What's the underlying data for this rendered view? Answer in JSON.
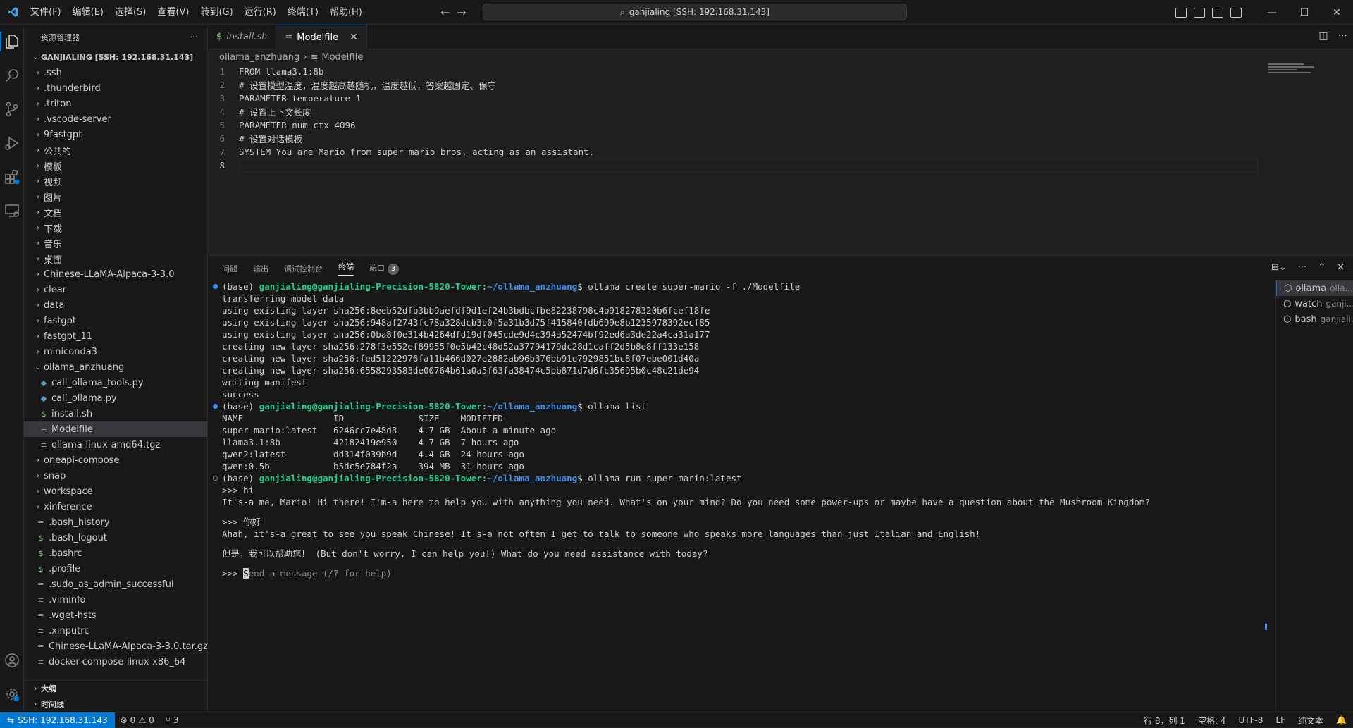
{
  "menu": [
    "文件(F)",
    "编辑(E)",
    "选择(S)",
    "查看(V)",
    "转到(G)",
    "运行(R)",
    "终端(T)",
    "帮助(H)"
  ],
  "command_center": "ganjialing [SSH: 192.168.31.143]",
  "sidebar": {
    "title": "资源管理器",
    "root": "GANJIALING [SSH: 192.168.31.143]",
    "items": [
      {
        "label": ".ssh",
        "type": "folder",
        "depth": 0
      },
      {
        "label": ".thunderbird",
        "type": "folder",
        "depth": 0
      },
      {
        "label": ".triton",
        "type": "folder",
        "depth": 0
      },
      {
        "label": ".vscode-server",
        "type": "folder",
        "depth": 0
      },
      {
        "label": "9fastgpt",
        "type": "folder",
        "depth": 0
      },
      {
        "label": "公共的",
        "type": "folder",
        "depth": 0
      },
      {
        "label": "模板",
        "type": "folder",
        "depth": 0
      },
      {
        "label": "视频",
        "type": "folder",
        "depth": 0
      },
      {
        "label": "图片",
        "type": "folder",
        "depth": 0
      },
      {
        "label": "文档",
        "type": "folder",
        "depth": 0
      },
      {
        "label": "下载",
        "type": "folder",
        "depth": 0
      },
      {
        "label": "音乐",
        "type": "folder",
        "depth": 0
      },
      {
        "label": "桌面",
        "type": "folder",
        "depth": 0
      },
      {
        "label": "Chinese-LLaMA-Alpaca-3-3.0",
        "type": "folder",
        "depth": 0
      },
      {
        "label": "clear",
        "type": "folder",
        "depth": 0
      },
      {
        "label": "data",
        "type": "folder",
        "depth": 0
      },
      {
        "label": "fastgpt",
        "type": "folder",
        "depth": 0
      },
      {
        "label": "fastgpt_11",
        "type": "folder",
        "depth": 0
      },
      {
        "label": "miniconda3",
        "type": "folder",
        "depth": 0
      },
      {
        "label": "ollama_anzhuang",
        "type": "folder-open",
        "depth": 0
      },
      {
        "label": "call_ollama_tools.py",
        "type": "py",
        "depth": 1
      },
      {
        "label": "call_ollama.py",
        "type": "py",
        "depth": 1
      },
      {
        "label": "install.sh",
        "type": "sh",
        "depth": 1
      },
      {
        "label": "Modelfile",
        "type": "text",
        "depth": 1,
        "selected": true
      },
      {
        "label": "ollama-linux-amd64.tgz",
        "type": "text",
        "depth": 1
      },
      {
        "label": "oneapi-compose",
        "type": "folder",
        "depth": 0
      },
      {
        "label": "snap",
        "type": "folder",
        "depth": 0
      },
      {
        "label": "workspace",
        "type": "folder",
        "depth": 0
      },
      {
        "label": "xinference",
        "type": "folder",
        "depth": 0
      },
      {
        "label": ".bash_history",
        "type": "text",
        "depth": 0
      },
      {
        "label": ".bash_logout",
        "type": "sh",
        "depth": 0
      },
      {
        "label": ".bashrc",
        "type": "sh",
        "depth": 0
      },
      {
        "label": ".profile",
        "type": "sh",
        "depth": 0
      },
      {
        "label": ".sudo_as_admin_successful",
        "type": "text",
        "depth": 0
      },
      {
        "label": ".viminfo",
        "type": "text",
        "depth": 0
      },
      {
        "label": ".wget-hsts",
        "type": "text",
        "depth": 0
      },
      {
        "label": ".xinputrc",
        "type": "text",
        "depth": 0
      },
      {
        "label": "Chinese-LLaMA-Alpaca-3-3.0.tar.gz",
        "type": "text",
        "depth": 0
      },
      {
        "label": "docker-compose-linux-x86_64",
        "type": "text",
        "depth": 0
      }
    ],
    "outline": "大纲",
    "timeline": "时间线"
  },
  "tabs": [
    {
      "label": "install.sh",
      "icon": "$",
      "active": false
    },
    {
      "label": "Modelfile",
      "icon": "≡",
      "active": true
    }
  ],
  "breadcrumb": [
    "ollama_anzhuang",
    "Modelfile"
  ],
  "code": [
    "FROM llama3.1:8b",
    "# 设置模型温度，温度越高越随机，温度越低，答案越固定、保守",
    "PARAMETER temperature 1",
    "# 设置上下文长度",
    "PARAMETER num_ctx 4096",
    "# 设置对话模板",
    "SYSTEM You are Mario from super mario bros, acting as an assistant.",
    ""
  ],
  "current_line": 8,
  "panel": {
    "tabs": [
      "问题",
      "输出",
      "调试控制台",
      "终端",
      "端口"
    ],
    "active_tab": "终端",
    "ports_badge": "3"
  },
  "terminal": {
    "prompt_prefix": "(base) ",
    "user_host": "ganjialing@ganjialing-Precision-5820-Tower",
    "path": "~/ollama_anzhuang",
    "cmd1": "$ ollama create super-mario -f ./Modelfile",
    "out1": [
      "transferring model data",
      "using existing layer sha256:8eeb52dfb3bb9aefdf9d1ef24b3bdbcfbe82238798c4b918278320b6fcef18fe",
      "using existing layer sha256:948af2743fc78a328dcb3b0f5a31b3d75f415840fdb699e8b1235978392ecf85",
      "using existing layer sha256:0ba8f0e314b4264dfd19df045cde9d4c394a52474bf92ed6a3de22a4ca31a177",
      "creating new layer sha256:278f3e552ef89955f0e5b42c48d52a37794179dc28d1caff2d5b8e8ff133e158",
      "creating new layer sha256:fed51222976fa11b466d027e2882ab96b376bb91e7929851bc8f07ebe001d40a",
      "creating new layer sha256:6558293583de00764b61a0a5f63fa38474c5bb871d7d6fc35695b0c48c21de94",
      "writing manifest",
      "success"
    ],
    "cmd2": "$ ollama list",
    "out2": [
      "NAME                 ID              SIZE    MODIFIED",
      "super-mario:latest   6246cc7e48d3    4.7 GB  About a minute ago",
      "llama3.1:8b          42182419e950    4.7 GB  7 hours ago",
      "qwen2:latest         dd314f039b9d    4.4 GB  24 hours ago",
      "qwen:0.5b            b5dc5e784f2a    394 MB  31 hours ago"
    ],
    "cmd3": "$ ollama run super-mario:latest",
    "chat": [
      ">>> hi",
      "It's-a me, Mario! Hi there! I'm-a here to help you with anything you need. What's on your mind? Do you need some power-ups or maybe have a question about the Mushroom Kingdom?",
      "",
      ">>> 你好",
      "Ahah, it's-a great to see you speak Chinese! It's-a not often I get to talk to someone who speaks more languages than just Italian and English!",
      "",
      "但是，我可以帮助您！ (But don't worry, I can help you!) What do you need assistance with today?",
      ""
    ],
    "input_prompt": ">>> ",
    "input_cursor_char": "S",
    "input_placeholder_rest": "end a message (/? for help)"
  },
  "terminal_list": [
    {
      "name": "ollama",
      "sub": "olla...",
      "active": true
    },
    {
      "name": "watch",
      "sub": "ganji...",
      "active": false
    },
    {
      "name": "bash",
      "sub": "ganjiali...",
      "active": false
    }
  ],
  "status": {
    "remote": "SSH: 192.168.31.143",
    "errors": "0",
    "warnings": "0",
    "ports": "3",
    "position": "行 8，列 1",
    "spaces": "空格: 4",
    "encoding": "UTF-8",
    "eol": "LF",
    "language": "纯文本"
  },
  "colors": {
    "accent": "#0078d4",
    "user_host": "#23d18b",
    "path": "#3b8eea"
  }
}
